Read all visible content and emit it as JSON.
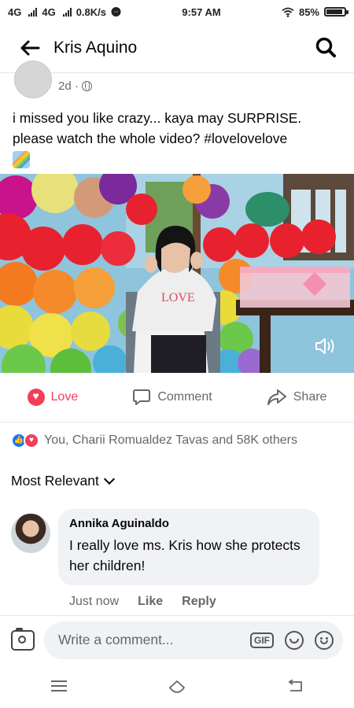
{
  "status_bar": {
    "network1": "4G",
    "network2": "4G",
    "speed": "0.8K/s",
    "time": "9:57 AM",
    "battery": "85%",
    "battery_level": 0.85
  },
  "header": {
    "title": "Kris Aquino"
  },
  "post": {
    "time_ago": "2d ·",
    "text": "i missed you like crazy... kaya may SURPRISE. please watch the whole video? #lovelovelove"
  },
  "actions": {
    "love": "Love",
    "comment": "Comment",
    "share": "Share"
  },
  "reactions": {
    "summary": "You, Charii Romualdez Tavas and 58K others"
  },
  "comments_sort": {
    "label": "Most Relevant"
  },
  "comment": {
    "author": "Annika Aguinaldo",
    "text": "I really love ms. Kris how she protects her children!",
    "time": "Just now",
    "like": "Like",
    "reply": "Reply"
  },
  "composer": {
    "placeholder": "Write a comment...",
    "gif": "GIF"
  },
  "video_art": {
    "hoodie_text": "LOVE"
  },
  "colors": {
    "love": "#f33e58",
    "like": "#1877f2",
    "muted": "#65676b"
  }
}
